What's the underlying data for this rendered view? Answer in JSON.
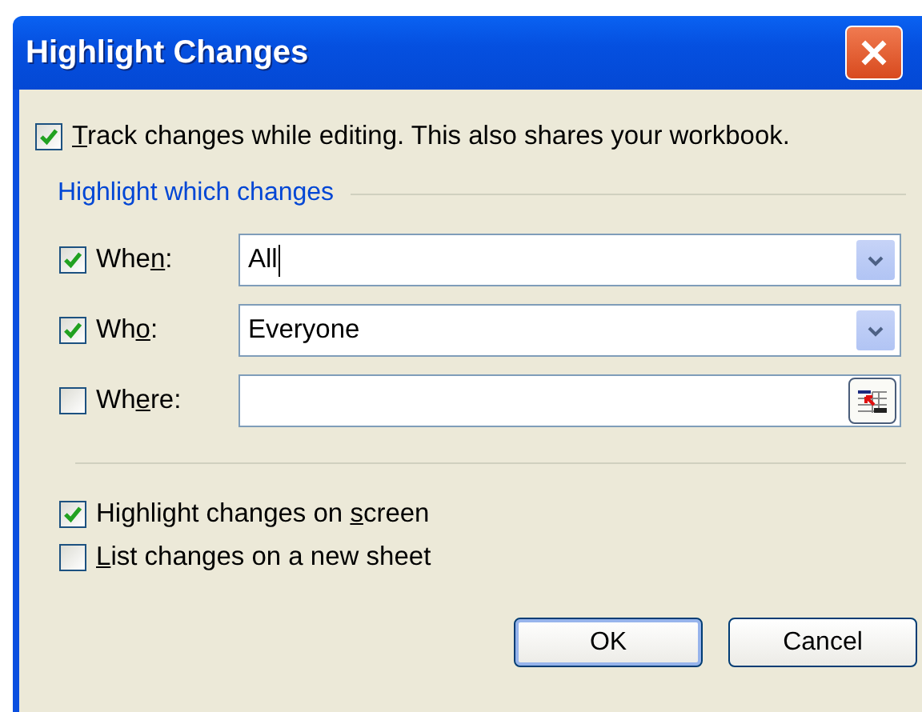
{
  "window": {
    "title": "Highlight Changes"
  },
  "track_changes": {
    "label": {
      "key": "T",
      "after": "rack changes while editing. This also shares your workbook."
    },
    "checked": true
  },
  "group": {
    "title": "Highlight which changes",
    "filters": [
      {
        "kind": "dropdown",
        "label": {
          "before": "Whe",
          "key": "n",
          "after": ":"
        },
        "checked": true,
        "value": "All",
        "focused": true
      },
      {
        "kind": "dropdown",
        "label": {
          "before": "Wh",
          "key": "o",
          "after": ":"
        },
        "checked": true,
        "value": "Everyone",
        "focused": false
      },
      {
        "kind": "range",
        "label": {
          "before": "Wh",
          "key": "e",
          "after": "re:"
        },
        "checked": false,
        "focused": false
      }
    ]
  },
  "options": [
    {
      "label": {
        "before": "Highlight changes on ",
        "key": "s",
        "after": "creen"
      },
      "checked": true
    },
    {
      "label": {
        "key": "L",
        "after": "ist changes on a new sheet"
      },
      "checked": false
    }
  ],
  "buttons": [
    "OK",
    "Cancel"
  ]
}
